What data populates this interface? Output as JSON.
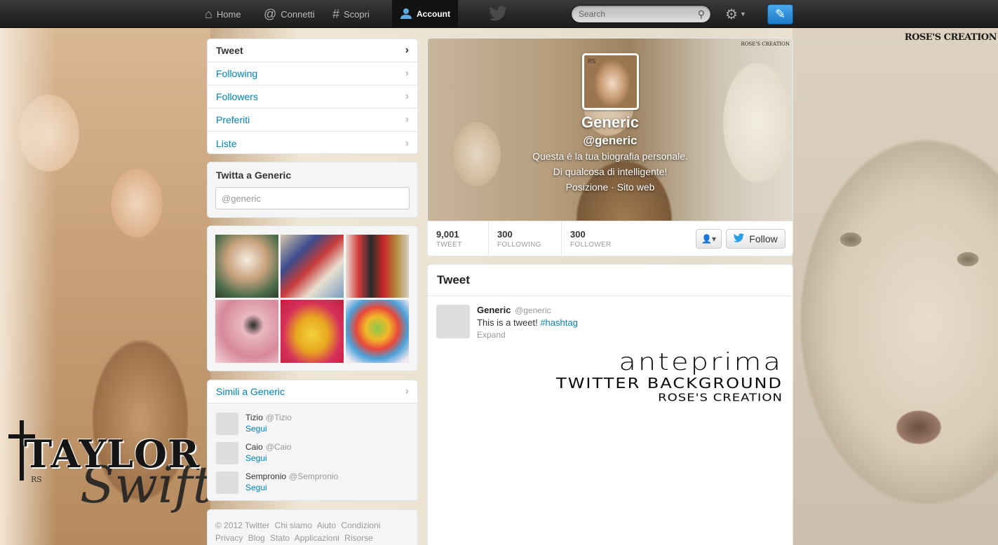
{
  "topbar": {
    "nav": [
      {
        "label": "Home",
        "icon": "home-icon"
      },
      {
        "label": "Connetti",
        "icon": "at-icon"
      },
      {
        "label": "Scopri",
        "icon": "hash-icon"
      },
      {
        "label": "Account",
        "icon": "user-icon"
      }
    ],
    "search_placeholder": "Search"
  },
  "background": {
    "logo_topright": "ROSE'S CREATION",
    "logo_left_1": "TAYLOR",
    "logo_left_2": "Swift",
    "logo_left_mark": "RS"
  },
  "dashboard_nav": [
    {
      "label": "Tweet"
    },
    {
      "label": "Following"
    },
    {
      "label": "Followers"
    },
    {
      "label": "Preferiti"
    },
    {
      "label": "Liste"
    }
  ],
  "tweet_to": {
    "title": "Twitta a Generic",
    "placeholder": "@generic"
  },
  "similar": {
    "title": "Simili a Generic",
    "follow_label": "Segui",
    "users": [
      {
        "name": "Tizio",
        "handle": "@Tizio"
      },
      {
        "name": "Caio",
        "handle": "@Caio"
      },
      {
        "name": "Sempronio",
        "handle": "@Sempronio"
      }
    ]
  },
  "footer": {
    "links": [
      "© 2012 Twitter",
      "Chi siamo",
      "Aiuto",
      "Condizioni",
      "Privacy",
      "Blog",
      "Stato",
      "Applicazioni",
      "Risorse"
    ]
  },
  "profile": {
    "cover_mark": "ROSE'S CREATION",
    "avatar_mark": "RS",
    "name": "Generic",
    "handle": "@generic",
    "bio_1": "Questa è la tua biografia personale.",
    "bio_2": "Di qualcosa di intelligente!",
    "bio_3": "Posizione · Sito web",
    "stats": [
      {
        "value": "9,001",
        "label": "TWEET"
      },
      {
        "value": "300",
        "label": "FOLLOWING"
      },
      {
        "value": "300",
        "label": "FOLLOWER"
      }
    ],
    "follow_label": "Follow"
  },
  "stream": {
    "title": "Tweet",
    "tweet": {
      "name": "Generic",
      "handle": "@generic",
      "text": "This is a tweet!",
      "hashtag": "#hashtag",
      "expand": "Expand"
    },
    "preview": {
      "line1": "anteprima",
      "line2": "Twitter Background",
      "line3": "Rose's Creation"
    }
  },
  "colors": {
    "link": "#0084b4",
    "compose": "#2b8fe0",
    "topbar": "#262626"
  }
}
